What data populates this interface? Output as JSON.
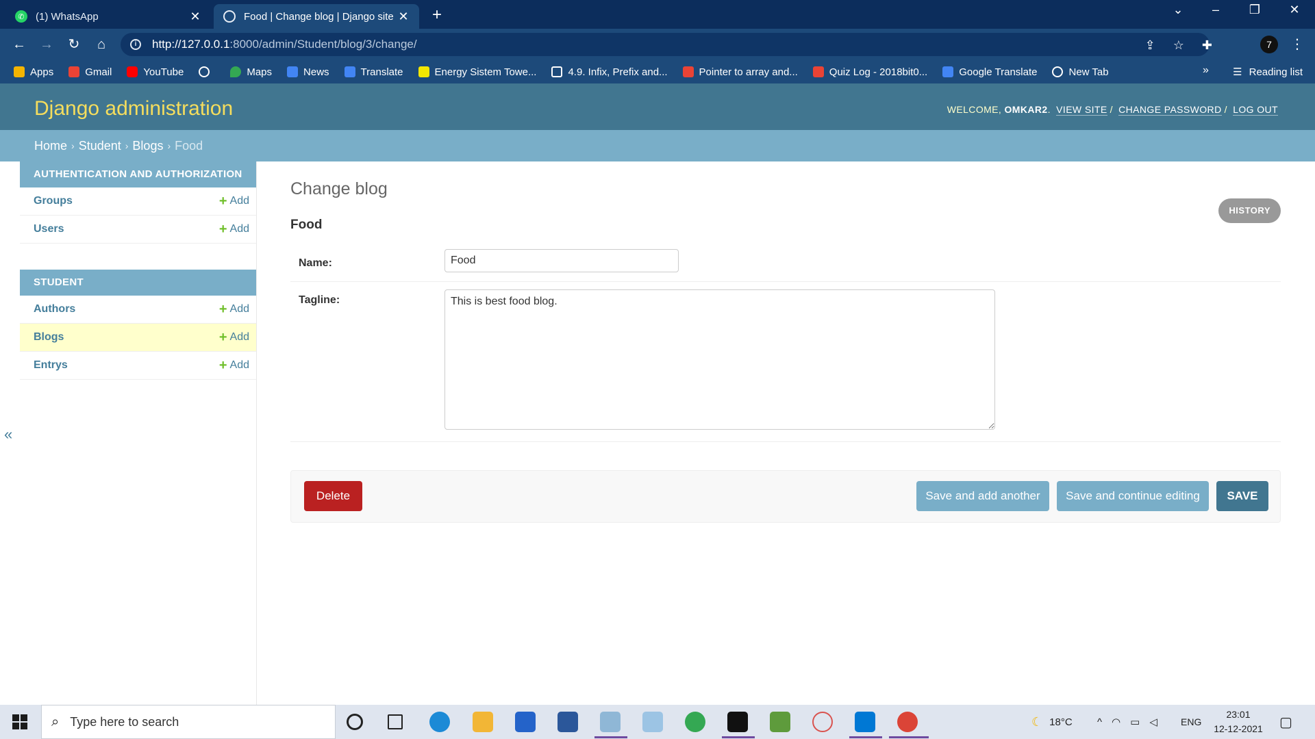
{
  "browser": {
    "tabs": [
      {
        "title": "(1) WhatsApp",
        "active": false
      },
      {
        "title": "Food | Change blog | Django site",
        "active": true
      }
    ],
    "url_host": "http://127.0.0.1",
    "url_rest": ":8000/admin/Student/blog/3/change/",
    "profile_initial": "7",
    "bookmarks": [
      {
        "label": "Apps",
        "icon": "apps-grid-icon",
        "color": "#f4b400"
      },
      {
        "label": "Gmail",
        "icon": "gmail-icon",
        "color": "#ea4335"
      },
      {
        "label": "YouTube",
        "icon": "youtube-icon",
        "color": "#ff0000"
      },
      {
        "label": "",
        "icon": "globe-icon",
        "color": "#ffffff"
      },
      {
        "label": "Maps",
        "icon": "maps-icon",
        "color": "#34a853"
      },
      {
        "label": "News",
        "icon": "news-icon",
        "color": "#4285f4"
      },
      {
        "label": "Translate",
        "icon": "translate-icon",
        "color": "#4285f4"
      },
      {
        "label": "Energy Sistem Towe...",
        "icon": "energy-icon",
        "color": "#f2e600"
      },
      {
        "label": "4.9. Infix, Prefix and...",
        "icon": "book-icon",
        "color": "#ffffff"
      },
      {
        "label": "Pointer to array and...",
        "icon": "gmail-icon",
        "color": "#ea4335"
      },
      {
        "label": "Quiz Log - 2018bit0...",
        "icon": "gmail-icon",
        "color": "#ea4335"
      },
      {
        "label": "Google Translate",
        "icon": "translate-icon",
        "color": "#4285f4"
      },
      {
        "label": "New Tab",
        "icon": "globe-icon",
        "color": "#ffffff"
      }
    ],
    "more_bookmarks": "»",
    "reading_list": "Reading list"
  },
  "admin": {
    "brand": "Django administration",
    "welcome": "WELCOME,",
    "username": "OMKAR2",
    "view_site": "VIEW SITE",
    "change_password": "CHANGE PASSWORD",
    "log_out": "LOG OUT",
    "breadcrumbs": {
      "home": "Home",
      "app": "Student",
      "model": "Blogs",
      "current": "Food",
      "separator": "›"
    },
    "sidebar": {
      "auth_caption": "AUTHENTICATION AND AUTHORIZATION",
      "auth_models": [
        {
          "name": "Groups",
          "add": "Add"
        },
        {
          "name": "Users",
          "add": "Add"
        }
      ],
      "student_caption": "STUDENT",
      "student_models": [
        {
          "name": "Authors",
          "add": "Add",
          "selected": false
        },
        {
          "name": "Blogs",
          "add": "Add",
          "selected": true
        },
        {
          "name": "Entrys",
          "add": "Add",
          "selected": false
        }
      ],
      "collapse": "«"
    },
    "form": {
      "page_title": "Change blog",
      "history": "HISTORY",
      "object_title": "Food",
      "name_label": "Name:",
      "name_value": "Food",
      "tagline_label": "Tagline:",
      "tagline_value": "This is best food blog."
    },
    "buttons": {
      "delete": "Delete",
      "save_add_another": "Save and add another",
      "save_continue": "Save and continue editing",
      "save": "SAVE"
    }
  },
  "taskbar": {
    "search_placeholder": "Type here to search",
    "weather": "18°C",
    "language": "ENG",
    "time": "23:01",
    "date": "12-12-2021"
  }
}
